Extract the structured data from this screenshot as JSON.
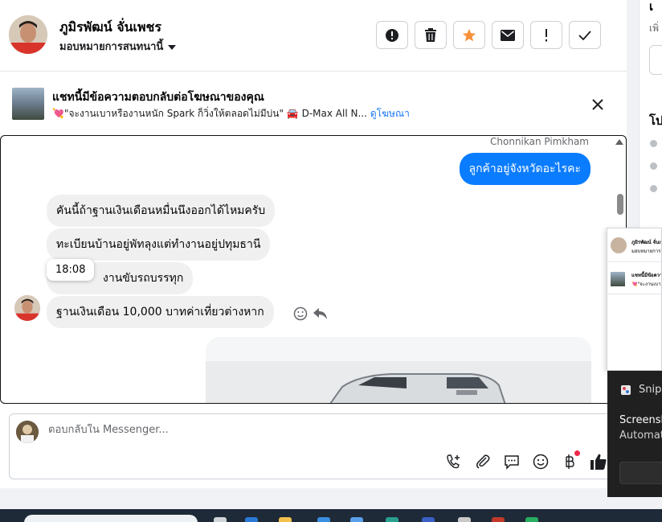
{
  "header": {
    "name": "ภูมิรพัฒน์ จั่นเพชร",
    "assign_label": "มอบหมายการสนทนานี้",
    "buttons": [
      "spam-report",
      "delete",
      "star",
      "mark-unread",
      "follow-up",
      "done"
    ],
    "star_color": "#f7923b"
  },
  "ad_banner": {
    "title": "แชทนี้มีข้อความตอบกลับต่อโฆษณาของคุณ",
    "text": "💘\"จะงานเบาหรืองานหนัก Spark ก็วิ่งให้ตลอดไม่มีบ่น\" 🚘 D-Max All N...",
    "link": "ดูโฆษณา"
  },
  "chat": {
    "agent_name": "Chonnikan Pimkham",
    "outgoing": "ลูกค้าอยู่จังหวัดอะไรคะ",
    "incoming": [
      "คันนี้ถ้าฐานเงินเดือนหมื่นนึงออกได้ไหมครับ",
      "ทะเบียนบ้านอยู่พัทลุงแต่ทำงานอยู่ปทุมธานี",
      "งานขับรถบรรทุก",
      "ฐานเงินเดือน 10,000 บาทค่าเที่ยวต่างหาก"
    ],
    "timestamp": "18:08",
    "bubble_out_color": "#0a7cff"
  },
  "composer": {
    "placeholder": "ตอบกลับใน Messenger..."
  },
  "right_panel": {
    "title1": "เ",
    "sub": "เพิ่",
    "title2": "โป"
  },
  "popup": {
    "row1_name": "ภูมิรพัฒน์ จั่นเพชร",
    "row1_sub": "มอบหมายการสนทนานี้",
    "row2_title": "แชทนี้มีข้อความ",
    "row2_sub": "💘\"จะงานเบาหรืองานหนัก"
  },
  "toast": {
    "app_name": "Snipping Tool",
    "title": "Screenshot copied",
    "body": "Automatically saved"
  }
}
